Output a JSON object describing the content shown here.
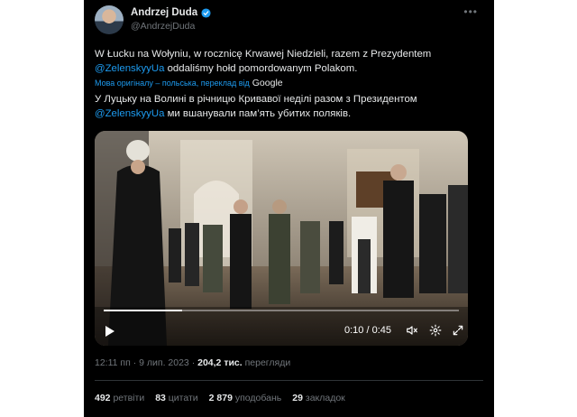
{
  "author": {
    "name": "Andrzej Duda",
    "handle": "@AndrzejDuda"
  },
  "tweet": {
    "original_part1": "W Łucku na Wołyniu, w rocznicę Krwawej Niedzieli, razem z Prezydentem",
    "mention": "@ZelenskyyUa",
    "original_part2": "oddaliśmy hołd pomordowanym Polakom.",
    "translation_label": "Мова оригіналу – польська, переклад від",
    "translation_provider": "Google",
    "translated_part1": "У Луцьку на Волині в річницю Кривавої неділі разом з Президентом",
    "translated_mention": "@ZelenskyyUa",
    "translated_part2": "ми вшанували пам’ять убитих поляків."
  },
  "video": {
    "time": "0:10 / 0:45",
    "progress": 0.22
  },
  "meta": {
    "time": "12:11 пп",
    "date": "9 лип. 2023",
    "views": "204,2 тис.",
    "views_label": "перегляди"
  },
  "stats": {
    "retweets": "492",
    "retweets_label": "ретвіти",
    "quotes": "83",
    "quotes_label": "цитати",
    "likes": "2 879",
    "likes_label": "уподобань",
    "bookmarks": "29",
    "bookmarks_label": "закладок"
  },
  "colors": {
    "background": "#000000",
    "text": "#e7e9ea",
    "muted": "#71767b",
    "accent": "#1d9bf0"
  }
}
